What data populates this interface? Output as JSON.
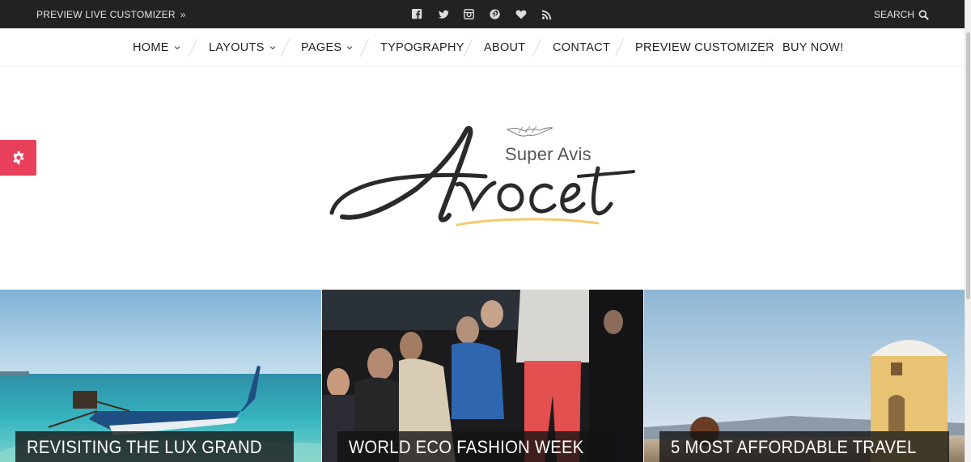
{
  "topbar": {
    "preview_label": "PREVIEW LIVE CUSTOMIZER",
    "preview_arrow": "»",
    "social": [
      "facebook-icon",
      "twitter-icon",
      "instagram-icon",
      "pinterest-icon",
      "heart-icon",
      "rss-icon"
    ],
    "search_label": "SEARCH"
  },
  "nav": {
    "items": [
      {
        "label": "HOME",
        "dropdown": true
      },
      {
        "label": "LAYOUTS",
        "dropdown": true
      },
      {
        "label": "PAGES",
        "dropdown": true
      },
      {
        "label": "TYPOGRAPHY",
        "dropdown": false
      },
      {
        "label": "ABOUT",
        "dropdown": false
      },
      {
        "label": "CONTACT",
        "dropdown": false
      },
      {
        "label": "PREVIEW CUSTOMIZER",
        "dropdown": false
      },
      {
        "label": "BUY NOW!",
        "dropdown": false
      }
    ]
  },
  "logo": {
    "tagline": "Super Avis",
    "name": "Avocet"
  },
  "cards": [
    {
      "title": "REVISITING THE LUX GRAND",
      "image": "beach-boat"
    },
    {
      "title": "WORLD ECO FASHION WEEK",
      "image": "fashion-runway"
    },
    {
      "title": "5 MOST AFFORDABLE TRAVEL",
      "image": "greek-island"
    }
  ],
  "colors": {
    "topbar": "#222222",
    "accent": "#e8405b",
    "logo_underline": "#f5c96a"
  }
}
